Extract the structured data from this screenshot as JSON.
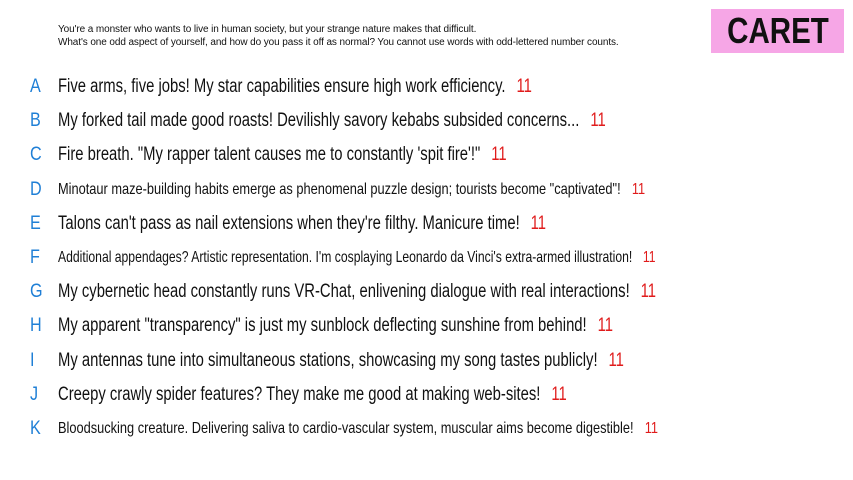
{
  "prompt": {
    "line1": "You're a monster who wants to live in human society, but your strange nature makes that difficult.",
    "line2": "What's one odd aspect of yourself, and how do you pass it off as normal? You cannot use words with odd-lettered number counts."
  },
  "logo": {
    "text": "CARET"
  },
  "colors": {
    "letter": "#1f7fd6",
    "count": "#e01b1b",
    "logo_bg": "#f6a6e6"
  },
  "answers": [
    {
      "letter": "A",
      "text": "Five arms, five jobs! My star capabilities ensure high work efficiency.",
      "count": "11"
    },
    {
      "letter": "B",
      "text": "My forked tail made good roasts! Devilishly savory kebabs subsided concerns...",
      "count": "11"
    },
    {
      "letter": "C",
      "text": "Fire breath. \"My rapper talent causes me to constantly 'spit fire'!\"",
      "count": "11"
    },
    {
      "letter": "D",
      "text": "Minotaur maze-building habits emerge as phenomenal puzzle design; tourists become \"captivated\"!",
      "count": "11"
    },
    {
      "letter": "E",
      "text": "Talons can't pass as nail extensions when they're filthy. Manicure time!",
      "count": "11"
    },
    {
      "letter": "F",
      "text": "Additional appendages? Artistic representation. I'm cosplaying Leonardo da Vinci's extra-armed illustration!",
      "count": "11"
    },
    {
      "letter": "G",
      "text": "My cybernetic head constantly runs VR-Chat, enlivening dialogue with real interactions!",
      "count": "11"
    },
    {
      "letter": "H",
      "text": "My apparent \"transparency\" is just my sunblock deflecting sunshine from behind!",
      "count": "11"
    },
    {
      "letter": "I",
      "text": "My antennas tune into simultaneous stations, showcasing my song tastes publicly!",
      "count": "11"
    },
    {
      "letter": "J",
      "text": "Creepy crawly spider features? They make me good at making web-sites!",
      "count": "11"
    },
    {
      "letter": "K",
      "text": "Bloodsucking creature. Delivering saliva to cardio-vascular system, muscular aims become digestible!",
      "count": "11"
    }
  ]
}
